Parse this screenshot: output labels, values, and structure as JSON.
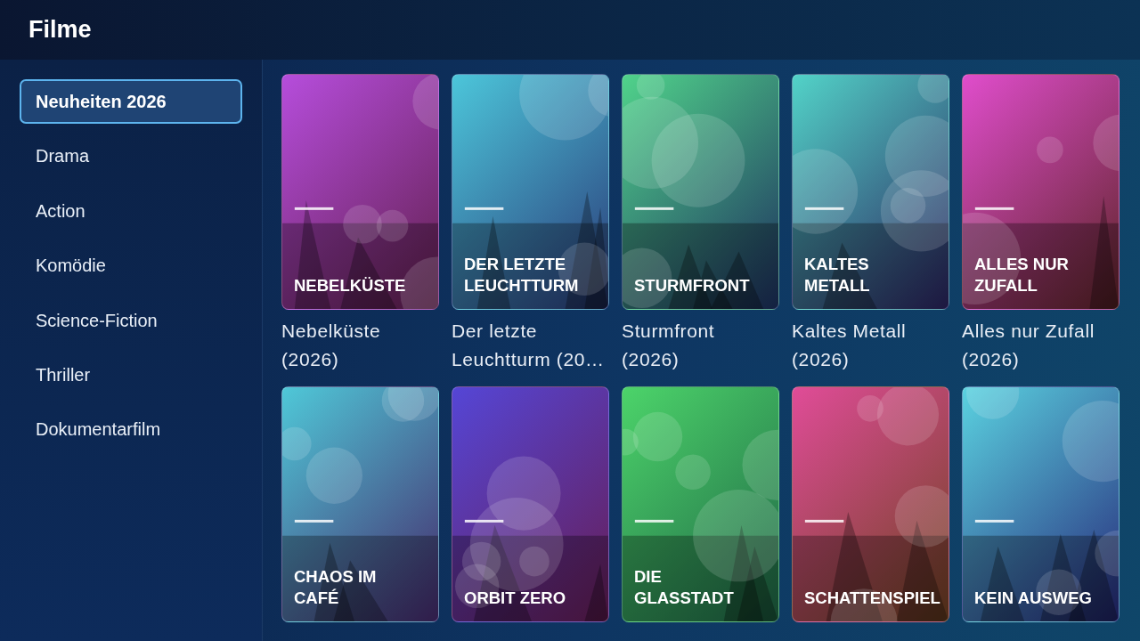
{
  "header": {
    "title": "Filme"
  },
  "sidebar": {
    "items": [
      {
        "label": "Neuheiten 2026",
        "selected": true
      },
      {
        "label": "Drama",
        "selected": false
      },
      {
        "label": "Action",
        "selected": false
      },
      {
        "label": "Komödie",
        "selected": false
      },
      {
        "label": "Science-Fiction",
        "selected": false
      },
      {
        "label": "Thriller",
        "selected": false
      },
      {
        "label": "Dokumentarfilm",
        "selected": false
      }
    ]
  },
  "movies": [
    {
      "poster_title": "NEBELKÜSTE",
      "caption": "Nebelküste (2026)"
    },
    {
      "poster_title": "DER LETZTE LEUCHTTURM",
      "caption": "Der letzte Leuchtturm (20…"
    },
    {
      "poster_title": "STURMFRONT",
      "caption": "Sturmfront (2026)"
    },
    {
      "poster_title": "KALTES METALL",
      "caption": "Kaltes Metall (2026)"
    },
    {
      "poster_title": "ALLES NUR ZUFALL",
      "caption": "Alles nur Zufall (2026)"
    },
    {
      "poster_title": "CHAOS IM CAFÉ"
    },
    {
      "poster_title": "ORBIT ZERO"
    },
    {
      "poster_title": "DIE GLASSTADT"
    },
    {
      "poster_title": "SCHATTENSPIEL"
    },
    {
      "poster_title": "KEIN AUSWEG"
    }
  ]
}
